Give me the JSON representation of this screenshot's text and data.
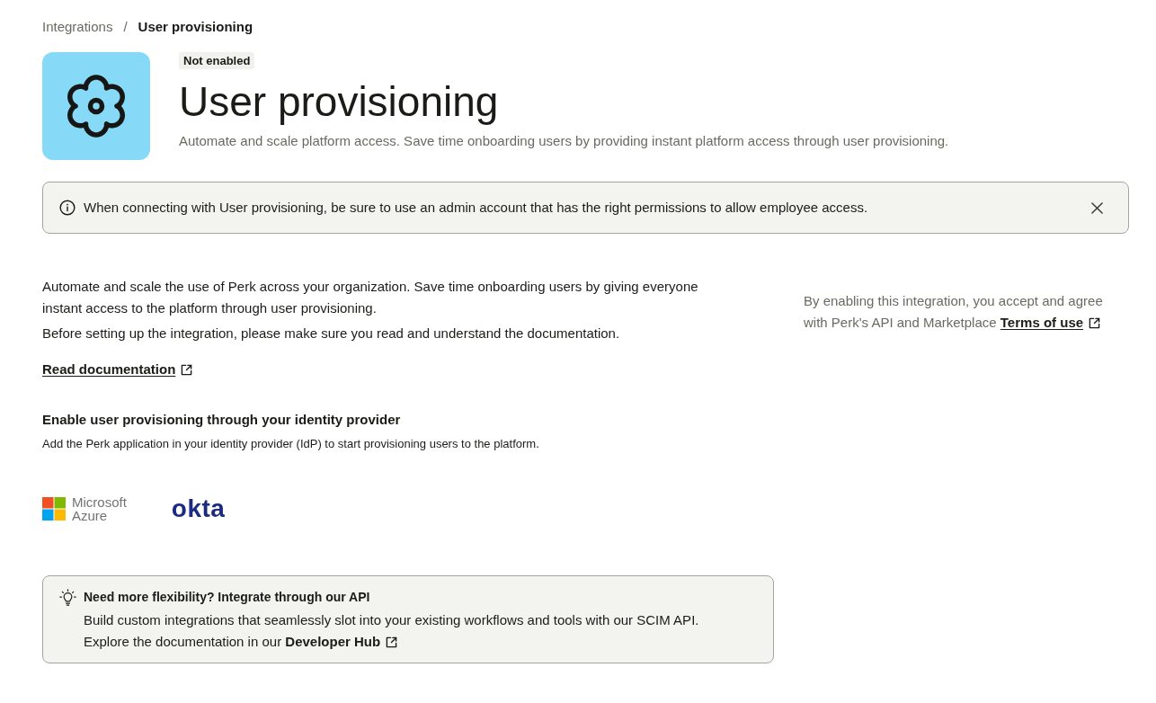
{
  "breadcrumb": {
    "separator": "/",
    "items": [
      {
        "label": "Integrations",
        "current": false
      },
      {
        "label": "User provisioning",
        "current": true
      }
    ]
  },
  "header": {
    "status_badge": "Not enabled",
    "title": "User provisioning",
    "subtitle": "Automate and scale platform access. Save time onboarding users by providing instant platform access through user provisioning."
  },
  "alert": {
    "text": "When connecting with User provisioning, be sure to use an admin account that has the right permissions to allow employee access."
  },
  "intro": {
    "paragraphs": [
      "Automate and scale the use of Perk across your organization. Save time onboarding users by giving everyone instant access to the platform through user provisioning.",
      "Before setting up the integration, please make sure you read and understand the documentation."
    ],
    "link": "Read documentation"
  },
  "terms": {
    "text": "By enabling this integration, you accept and agree with Perk's API and Marketplace",
    "link": "Terms of use"
  },
  "identity_providers": {
    "heading": "Enable user provisioning through your identity provider",
    "description": "Add the Perk application in your identity provider (IdP) to start provisioning users to the platform.",
    "providers": [
      {
        "kind": "azure",
        "name": "Microsoft Azure"
      },
      {
        "kind": "okta",
        "name": "okta"
      }
    ]
  },
  "api_callout": {
    "title": "Need more flexibility? Integrate through our API",
    "body": "Build custom integrations that seamlessly slot into your existing workflows and tools with our SCIM API.",
    "explore_text": "Explore the documentation in our",
    "link": "Developer Hub"
  }
}
